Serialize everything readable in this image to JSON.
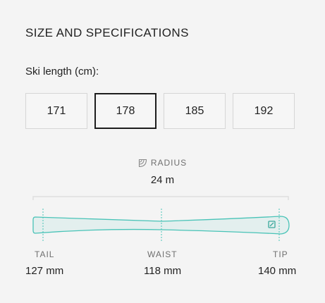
{
  "section": {
    "title": "SIZE AND SPECIFICATIONS"
  },
  "ski_length": {
    "label": "Ski length (cm):",
    "options": [
      "171",
      "178",
      "185",
      "192"
    ],
    "selected": "178"
  },
  "radius": {
    "label": "RADIUS",
    "value": "24 m",
    "icon": "radius-icon"
  },
  "measurements": {
    "tail": {
      "label": "TAIL",
      "value": "127 mm"
    },
    "waist": {
      "label": "WAIST",
      "value": "118 mm"
    },
    "tip": {
      "label": "TIP",
      "value": "140 mm"
    }
  },
  "colors": {
    "ski_outline": "#49c3b7",
    "ski_fill": "#e3efee",
    "selected_border": "#1d1d1d",
    "option_border": "#d6d6d6"
  }
}
